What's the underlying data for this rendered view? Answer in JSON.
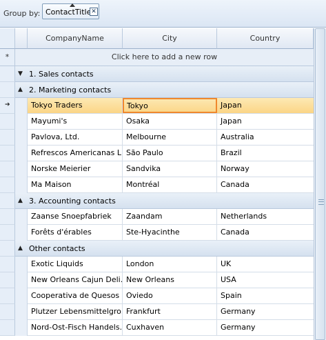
{
  "group_panel": {
    "label": "Group by:",
    "chip": "ContactTitle"
  },
  "columns": [
    "CompanyName",
    "City",
    "Country"
  ],
  "new_row_text": "Click here to add a new row",
  "new_row_marker": "*",
  "groups": [
    {
      "title": "1. Sales contacts",
      "expanded": false,
      "rows": []
    },
    {
      "title": "2. Marketing contacts",
      "expanded": true,
      "rows": [
        [
          "Tokyo Traders",
          "Tokyo",
          "Japan"
        ],
        [
          "Mayumi's",
          "Osaka",
          "Japan"
        ],
        [
          "Pavlova, Ltd.",
          "Melbourne",
          "Australia"
        ],
        [
          "Refrescos Americanas L...",
          "São Paulo",
          "Brazil"
        ],
        [
          "Norske Meierier",
          "Sandvika",
          "Norway"
        ],
        [
          "Ma Maison",
          "Montréal",
          "Canada"
        ]
      ]
    },
    {
      "title": "3. Accounting contacts",
      "expanded": true,
      "rows": [
        [
          "Zaanse Snoepfabriek",
          "Zaandam",
          "Netherlands"
        ],
        [
          "Forêts d'érables",
          "Ste-Hyacinthe",
          "Canada"
        ]
      ]
    },
    {
      "title": "Other contacts",
      "expanded": true,
      "rows": [
        [
          "Exotic Liquids",
          "London",
          "UK"
        ],
        [
          "New Orleans Cajun Deli...",
          "New Orleans",
          "USA"
        ],
        [
          "Cooperativa de Quesos '...",
          "Oviedo",
          "Spain"
        ],
        [
          "Plutzer Lebensmittelgro...",
          "Frankfurt",
          "Germany"
        ],
        [
          "Nord-Ost-Fisch Handels...",
          "Cuxhaven",
          "Germany"
        ]
      ]
    }
  ],
  "current_row": {
    "group": 1,
    "row": 0,
    "cell": 1
  },
  "colors": {
    "current_row": "#fbd586",
    "current_cell_border": "#f0882d",
    "header": "#e0e8f3"
  }
}
